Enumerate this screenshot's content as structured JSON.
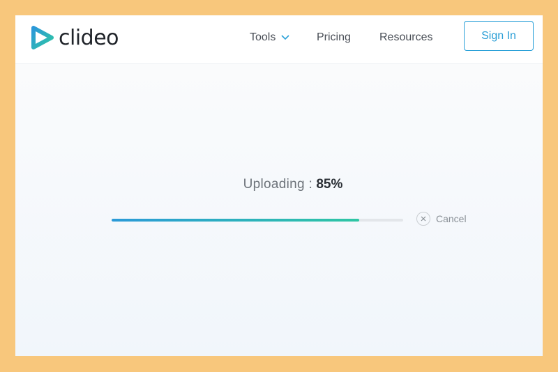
{
  "header": {
    "logo_text": "clideo",
    "logo_icon": "play-triangle-icon",
    "nav": [
      {
        "label": "Tools",
        "icon": "chevron-down-icon"
      },
      {
        "label": "Pricing"
      },
      {
        "label": "Resources"
      }
    ],
    "signin_label": "Sign In"
  },
  "upload": {
    "label": "Uploading :",
    "percent_text": "85%",
    "progress": 0.85,
    "cancel_label": "Cancel",
    "cancel_icon": "close-icon"
  },
  "colors": {
    "frame": "#f8c77c",
    "accent": "#2aa0d8",
    "progress_start": "#2b9ad8",
    "progress_end": "#2fc6a4"
  }
}
